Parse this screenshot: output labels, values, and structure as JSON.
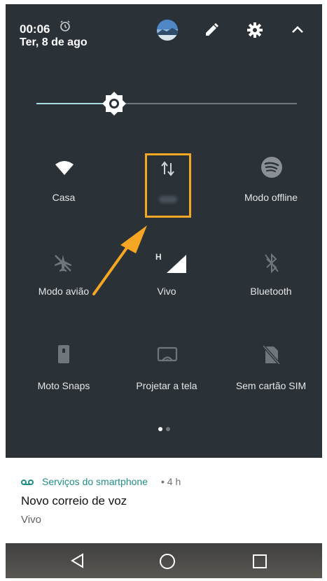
{
  "status": {
    "time": "00:06",
    "date": "Ter, 8 de ago"
  },
  "tiles": [
    {
      "label": "Casa",
      "icon": "wifi-icon"
    },
    {
      "label": "",
      "icon": "mobile-data-icon"
    },
    {
      "label": "Modo offline",
      "icon": "spotify-icon"
    },
    {
      "label": "Modo avião",
      "icon": "airplane-icon"
    },
    {
      "label": "Vivo",
      "icon": "signal-icon",
      "badge": "H"
    },
    {
      "label": "Bluetooth",
      "icon": "bluetooth-icon"
    },
    {
      "label": "Moto Snaps",
      "icon": "phone-icon"
    },
    {
      "label": "Projetar a tela",
      "icon": "cast-icon"
    },
    {
      "label": "Sem cartão SIM",
      "icon": "no-sim-icon"
    }
  ],
  "page_indicator": {
    "pages": 2,
    "current": 1
  },
  "notification": {
    "app": "Serviços do smartphone",
    "time": "• 4 h",
    "title": "Novo correio de voz",
    "subtitle": "Vivo"
  },
  "colors": {
    "panel": "#2a3137",
    "accent": "#f5a623",
    "notif_app": "#1f8f84"
  },
  "brightness_level": 0.3
}
